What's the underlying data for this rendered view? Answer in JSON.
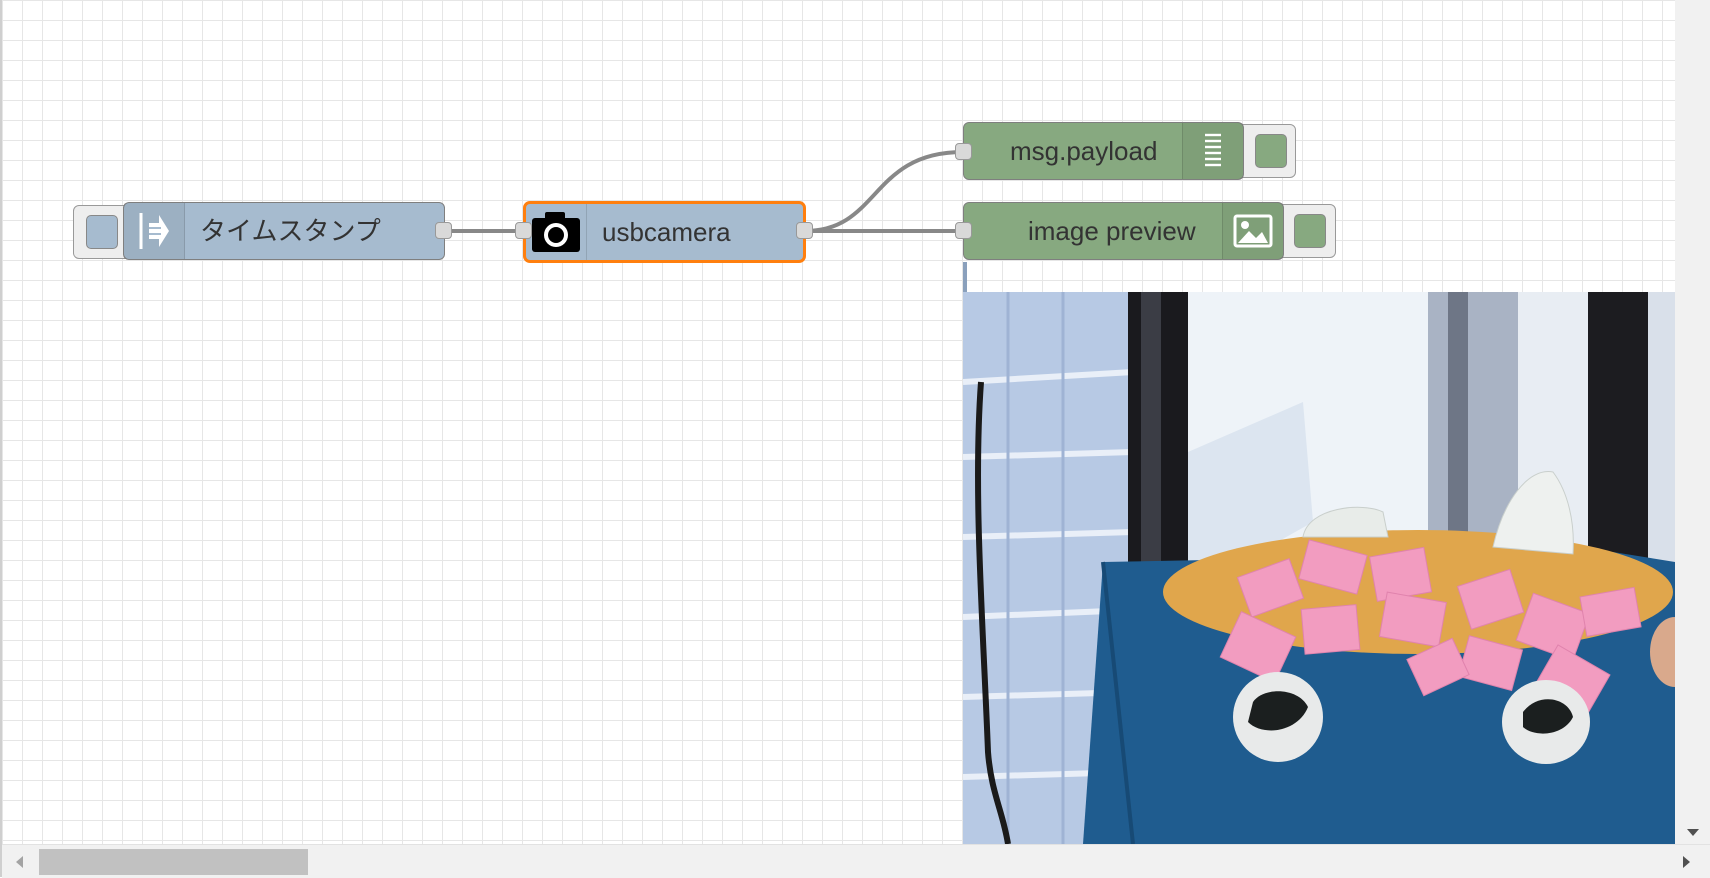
{
  "nodes": {
    "inject": {
      "label": "タイムスタンプ",
      "icon": "arrow-in-icon",
      "color": "#a6bbcf"
    },
    "camera": {
      "label": "usbcamera",
      "icon": "camera-icon",
      "color": "#a6bbcf",
      "selected_border": "#ff7f0e"
    },
    "debug": {
      "label": "msg.payload",
      "icon": "list-icon",
      "color": "#87a980"
    },
    "image_preview": {
      "label": "image preview",
      "icon": "image-icon",
      "color": "#87a980"
    }
  },
  "preview": {
    "description_icon": "camera-preview-image"
  },
  "scrollbars": {
    "horizontal": "h-scrollbar",
    "vertical": "v-scrollbar"
  }
}
